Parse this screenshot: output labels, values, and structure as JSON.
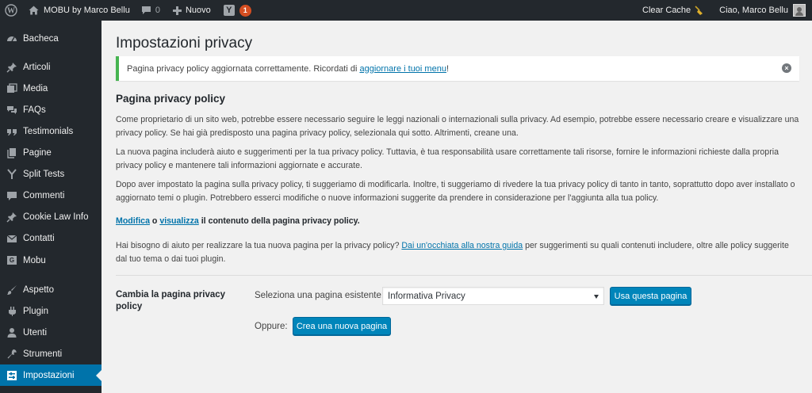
{
  "adminbar": {
    "site_name": "MOBU by Marco Bellu",
    "comments_count": "0",
    "new_label": "Nuovo",
    "yoast_badge": "1",
    "clear_cache": "Clear Cache",
    "greeting": "Ciao, Marco Bellu"
  },
  "sidebar": {
    "items": [
      {
        "label": "Bacheca",
        "icon": "dashboard-icon"
      },
      {
        "label": "Articoli",
        "icon": "pin-icon"
      },
      {
        "label": "Media",
        "icon": "media-icon"
      },
      {
        "label": "FAQs",
        "icon": "faq-icon"
      },
      {
        "label": "Testimonials",
        "icon": "quote-icon"
      },
      {
        "label": "Pagine",
        "icon": "page-icon"
      },
      {
        "label": "Split Tests",
        "icon": "split-icon"
      },
      {
        "label": "Commenti",
        "icon": "comment-icon"
      },
      {
        "label": "Cookie Law Info",
        "icon": "pin-icon"
      },
      {
        "label": "Contatti",
        "icon": "mail-icon"
      },
      {
        "label": "Mobu",
        "icon": "g-icon"
      },
      {
        "label": "Aspetto",
        "icon": "brush-icon"
      },
      {
        "label": "Plugin",
        "icon": "plugin-icon"
      },
      {
        "label": "Utenti",
        "icon": "user-icon"
      },
      {
        "label": "Strumenti",
        "icon": "wrench-icon"
      },
      {
        "label": "Impostazioni",
        "icon": "settings-icon",
        "current": true
      }
    ]
  },
  "main": {
    "title": "Impostazioni privacy",
    "notice": {
      "text_before": "Pagina privacy policy aggiornata correttamente. Ricordati di ",
      "link": "aggiornare i tuoi menu",
      "text_after": "!"
    },
    "section_title": "Pagina privacy policy",
    "paragraph1": "Come proprietario di un sito web, potrebbe essere necessario seguire le leggi nazionali o internazionali sulla privacy. Ad esempio, potrebbe essere necessario creare e visualizzare una privacy policy. Se hai già predisposto una pagina privacy policy, selezionala qui sotto. Altrimenti, creane una.",
    "paragraph2": "La nuova pagina includerà aiuto e suggerimenti per la tua privacy policy. Tuttavia, è tua responsabilità usare correttamente tali risorse, fornire le informazioni richieste dalla propria privacy policy e mantenere tali informazioni aggiornate e accurate.",
    "paragraph3": "Dopo aver impostato la pagina sulla privacy policy, ti suggeriamo di modificarla. Inoltre, ti suggeriamo di rivedere la tua privacy policy di tanto in tanto, soprattutto dopo aver installato o aggiornato temi o plugin. Potrebbero esserci modifiche o nuove informazioni suggerite da prendere in considerazione per l'aggiunta alla tua policy.",
    "edit_line": {
      "edit_link": "Modifica",
      "or": " o ",
      "view_link": "visualizza",
      "rest": " il contenuto della pagina privacy policy."
    },
    "help_line": {
      "before": "Hai bisogno di aiuto per realizzare la tua nuova pagina per la privacy policy? ",
      "link": "Dai un'occhiata alla nostra guida",
      "after": " per suggerimenti su quali contenuti includere, oltre alle policy suggerite dal tuo tema o dai tuoi plugin."
    },
    "change_label": "Cambia la pagina privacy policy",
    "select_label": "Seleziona una pagina esistente:",
    "select_value": "Informativa Privacy",
    "use_button": "Usa questa pagina",
    "or_label": "Oppure:",
    "create_button": "Crea una nuova pagina"
  },
  "colors": {
    "adminbar_bg": "#23282d",
    "accent": "#0073aa",
    "button": "#0085ba",
    "notice_success": "#46b450",
    "badge": "#d54e21"
  }
}
